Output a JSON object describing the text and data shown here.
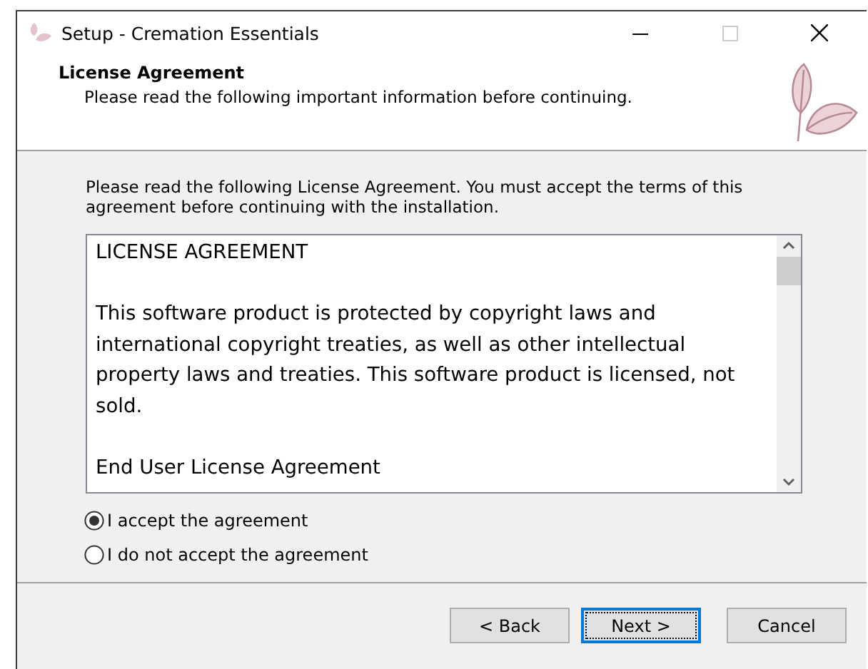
{
  "window": {
    "title": "Setup - Cremation Essentials",
    "maximize_disabled": true
  },
  "header": {
    "title": "License Agreement",
    "subtitle": "Please read the following important information before continuing."
  },
  "intro": "Please read the following License Agreement. You must accept the terms of this agreement before continuing with the installation.",
  "license_text": [
    "LICENSE AGREEMENT",
    "This software product is protected by copyright laws and international copyright treaties, as well as other intellectual property laws and treaties. This software product is licensed, not sold.",
    "End User License Agreement"
  ],
  "options": [
    {
      "label": "I accept the agreement",
      "selected": true
    },
    {
      "label": "I do not accept the agreement",
      "selected": false
    }
  ],
  "buttons": [
    {
      "label": "< Back",
      "default": false
    },
    {
      "label": "Next >",
      "default": true
    },
    {
      "label": "Cancel",
      "default": false
    }
  ]
}
